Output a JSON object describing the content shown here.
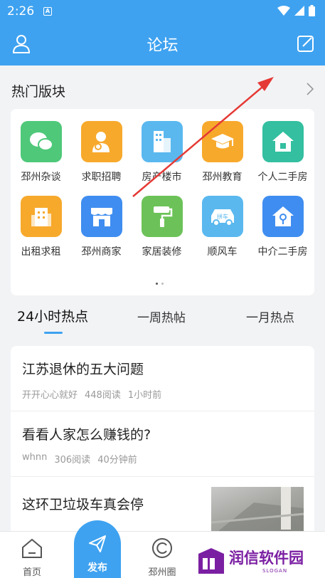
{
  "status_bar": {
    "time": "2:26",
    "indicator": "A"
  },
  "app_bar": {
    "title": "论坛"
  },
  "boards": {
    "title": "热门版块",
    "items": [
      {
        "label": "邳州杂谈",
        "icon": "chat-bubbles-icon",
        "color": "#4fc87a"
      },
      {
        "label": "求职招聘",
        "icon": "job-seeker-icon",
        "color": "#f7a92c"
      },
      {
        "label": "房产楼市",
        "icon": "building-icon",
        "color": "#5ab8ef"
      },
      {
        "label": "邳州教育",
        "icon": "graduation-cap-icon",
        "color": "#f7a92c"
      },
      {
        "label": "个人二手房",
        "icon": "house-icon",
        "color": "#33bfa0"
      },
      {
        "label": "出租求租",
        "icon": "rental-building-icon",
        "color": "#f7a92c"
      },
      {
        "label": "邳州商家",
        "icon": "storefront-icon",
        "color": "#3f8df0"
      },
      {
        "label": "家居装修",
        "icon": "paint-roller-icon",
        "color": "#6cc258"
      },
      {
        "label": "顺风车",
        "icon": "car-icon",
        "color": "#5ab8ef",
        "badge": "拼车"
      },
      {
        "label": "中介二手房",
        "icon": "house-key-icon",
        "color": "#3f8df0"
      }
    ]
  },
  "tabs": [
    {
      "label": "24小时热点",
      "active": true
    },
    {
      "label": "一周热帖",
      "active": false
    },
    {
      "label": "一月热点",
      "active": false
    }
  ],
  "posts": [
    {
      "title": "江苏退休的五大问题",
      "author": "开开心心就好",
      "reads": "448阅读",
      "time": "1小时前"
    },
    {
      "title": "看看人家怎么赚钱的?",
      "author": "whnn",
      "reads": "306阅读",
      "time": "40分钟前"
    },
    {
      "title": "这环卫垃圾车真会停"
    }
  ],
  "bottom_nav": {
    "home": "首页",
    "publish": "发布",
    "circle": "邳州圈"
  },
  "watermark": {
    "text": "润信软件园",
    "slogan": "SLOGAN"
  },
  "colors": {
    "accent": "#3ea2f0",
    "annotation": "#e53935",
    "watermark": "#7b1fa2"
  }
}
